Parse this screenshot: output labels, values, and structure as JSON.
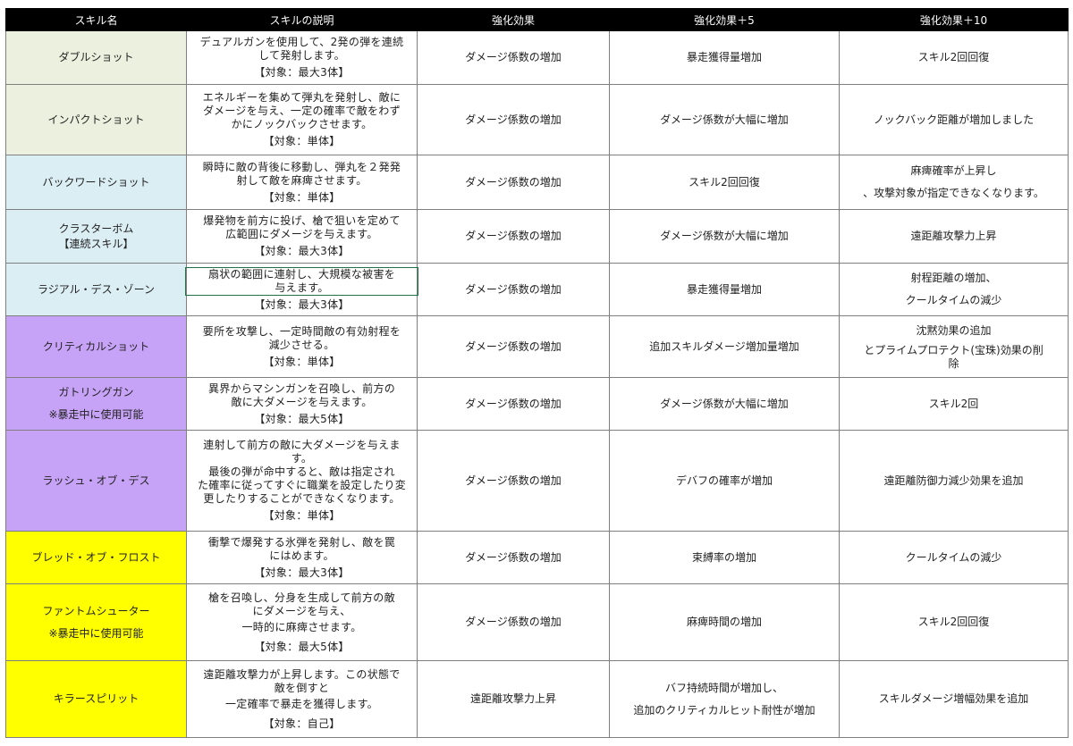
{
  "headers": [
    "スキル名",
    "スキルの説明",
    "強化効果",
    "強化効果＋5",
    "強化効果＋10"
  ],
  "colors": {
    "green": "#ebf1de",
    "blue": "#dbeef4",
    "purple": "#c7a3f7",
    "yellow": "#ffff00"
  },
  "rows": [
    {
      "name": [
        "ダブルショット"
      ],
      "desc": [
        "デュアルガンを使用して、2発の弾を連続",
        "して発射します。"
      ],
      "target": "【対象：最大3体】",
      "e0": [
        "ダメージ係数の増加"
      ],
      "e5": [
        "暴走獲得量増加"
      ],
      "e10": [
        "スキル2回回復"
      ]
    },
    {
      "name": [
        "インパクトショット"
      ],
      "desc": [
        "エネルギーを集めて弾丸を発射し、敵に",
        "ダメージを与え、一定の確率で敵をわず",
        "かにノックバックさせます。"
      ],
      "target": "【対象：単体】",
      "e0": [
        "ダメージ係数の増加"
      ],
      "e5": [
        "ダメージ係数が大幅に増加"
      ],
      "e10": [
        "ノックバック距離が増加しました"
      ]
    },
    {
      "name": [
        "バックワードショット"
      ],
      "desc": [
        "瞬時に敵の背後に移動し、弾丸を２発発",
        "射して敵を麻痺させます。"
      ],
      "target": "【対象：単体】",
      "e0": [
        "ダメージ係数の増加"
      ],
      "e5": [
        "スキル2回回復"
      ],
      "e10": [
        "麻痺確率が上昇し",
        "、攻撃対象が指定できなくなります。"
      ]
    },
    {
      "name": [
        "クラスターボム",
        "【連続スキル】"
      ],
      "desc": [
        "爆発物を前方に投げ、槍で狙いを定めて",
        "広範囲にダメージを与えます。"
      ],
      "target": "【対象：最大3体】",
      "e0": [
        "ダメージ係数の増加"
      ],
      "e5": [
        "ダメージ係数が大幅に増加"
      ],
      "e10": [
        "遠距離攻撃力上昇"
      ]
    },
    {
      "name": [
        "ラジアル・デス・ゾーン"
      ],
      "desc": [
        "扇状の範囲に連射し、大規模な被害を",
        "与えます。"
      ],
      "target": "【対象：最大3体】",
      "e0": [
        "ダメージ係数の増加"
      ],
      "e5": [
        "暴走獲得量増加"
      ],
      "e10": [
        "射程距離の増加、",
        "クールタイムの減少"
      ]
    },
    {
      "name": [
        "クリティカルショット"
      ],
      "desc": [
        "要所を攻撃し、一定時間敵の有効射程を",
        "減少させる。"
      ],
      "target": "【対象：単体】",
      "e0": [
        "ダメージ係数の増加"
      ],
      "e5": [
        "追加スキルダメージ増加量増加"
      ],
      "e10": [
        "沈黙効果の追加",
        "とプライムプロテクト(宝珠)効果の削",
        "除"
      ]
    },
    {
      "name": [
        "ガトリングガン",
        "※暴走中に使用可能"
      ],
      "desc": [
        "異界からマシンガンを召喚し、前方の",
        "敵に大ダメージを与えます。"
      ],
      "target": "【対象：最大5体】",
      "e0": [
        "ダメージ係数の増加"
      ],
      "e5": [
        "ダメージ係数が大幅に増加"
      ],
      "e10": [
        "スキル2回"
      ]
    },
    {
      "name": [
        "ラッシュ・オブ・デス"
      ],
      "desc": [
        "連射して前方の敵に大ダメージを与えま",
        "す。",
        "最後の弾が命中すると、敵は指定され",
        "た確率に従ってすぐに職業を設定したり変",
        "更したりすることができなくなります。"
      ],
      "target": "【対象：単体】",
      "e0": [
        "ダメージ係数の増加"
      ],
      "e5": [
        "デバフの確率が増加"
      ],
      "e10": [
        "遠距離防御力減少効果を追加"
      ]
    },
    {
      "name": [
        "ブレッド・オブ・フロスト"
      ],
      "desc": [
        "衝撃で爆発する氷弾を発射し、敵を罠",
        "にはめます。"
      ],
      "target": "【対象：最大3体】",
      "e0": [
        "ダメージ係数の増加"
      ],
      "e5": [
        "束縛率の増加"
      ],
      "e10": [
        "クールタイムの減少"
      ]
    },
    {
      "name": [
        "ファントムシューター",
        "※暴走中に使用可能"
      ],
      "desc": [
        "槍を召喚し、分身を生成して前方の敵",
        "にダメージを与え、",
        "一時的に麻痺させます。"
      ],
      "target": "【対象：最大5体】",
      "e0": [
        "ダメージ係数の増加"
      ],
      "e5": [
        "麻痺時間の増加"
      ],
      "e10": [
        "スキル2回回復"
      ]
    },
    {
      "name": [
        "キラースピリット"
      ],
      "desc": [
        "遠距離攻撃力が上昇します。この状態で",
        "敵を倒すと",
        "一定確率で暴走を獲得します。"
      ],
      "target": "【対象：自己】",
      "e0": [
        "遠距離攻撃力上昇"
      ],
      "e5": [
        "バフ持続時間が増加し、",
        "追加のクリティカルヒット耐性が増加"
      ],
      "e10": [
        "スキルダメージ増幅効果を追加"
      ]
    }
  ]
}
